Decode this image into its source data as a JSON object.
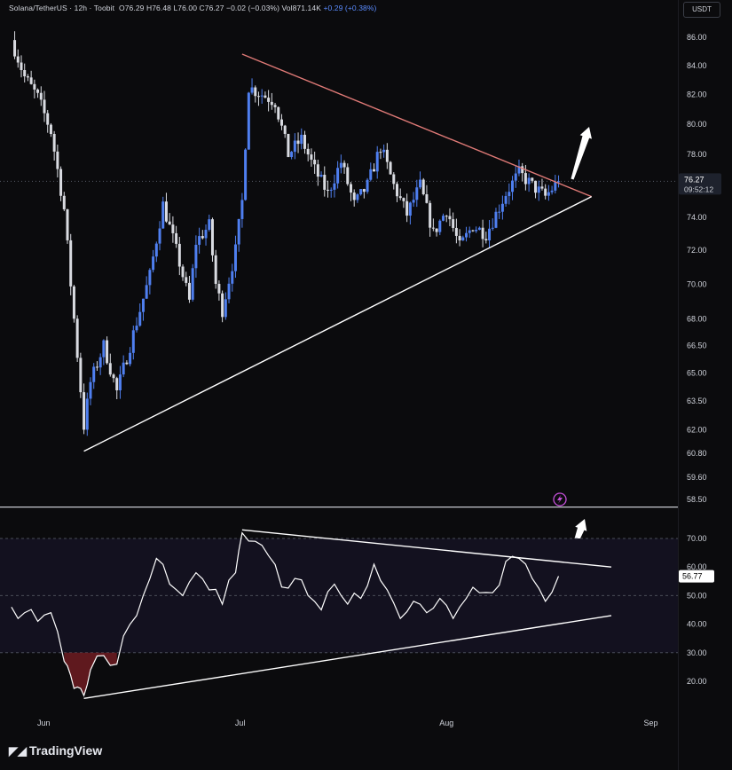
{
  "header": {
    "symbol": "Solana/TetherUS · 12h · Toobit",
    "open": "O76.29",
    "high": "H76.48",
    "low": "L76.00",
    "close": "C76.27",
    "change": "−0.02 (−0.03%)",
    "volume": "Vol871.14K",
    "vol_change": "+0.29 (+0.38%)",
    "currency_badge": "USDT"
  },
  "footer": {
    "brand": "TradingView",
    "logo_icon": "tradingview-logo-icon"
  },
  "price_badge": {
    "price": "76.27",
    "countdown": "09:52:12"
  },
  "rsi_badge": {
    "value": "56.77"
  },
  "colors": {
    "background": "#0b0b0d",
    "up_candle": "#4f7ff0",
    "down_candle": "#d9dbe1",
    "resistance_line": "#e07a77",
    "support_line": "#ffffff",
    "rsi_band": "#13111f",
    "rsi_line": "#ffffff",
    "oversold_fill": "#6e1c22"
  },
  "chart_data": [
    {
      "type": "candlestick",
      "name": "Solana/TetherUS 12h",
      "y_axis_ticks": [
        "86.00",
        "84.00",
        "82.00",
        "80.00",
        "78.00",
        "76.00",
        "74.00",
        "72.00",
        "70.00",
        "68.00",
        "66.50",
        "65.00",
        "63.50",
        "62.00",
        "60.80",
        "59.60",
        "58.50"
      ],
      "y_scale": "log",
      "x_axis_ticks": [
        "Jun",
        "Jul",
        "Aug",
        "Sep"
      ],
      "current_price": 76.27,
      "close_path_approx": [
        {
          "x": "May 27",
          "y": 85.8
        },
        {
          "x": "May 29",
          "y": 83.2
        },
        {
          "x": "May 31",
          "y": 81.8
        },
        {
          "x": "Jun 2",
          "y": 79.5
        },
        {
          "x": "Jun 4",
          "y": 74.5
        },
        {
          "x": "Jun 5",
          "y": 70.0
        },
        {
          "x": "Jun 6",
          "y": 66.0
        },
        {
          "x": "Jun 7",
          "y": 62.2
        },
        {
          "x": "Jun 8",
          "y": 64.5
        },
        {
          "x": "Jun 10",
          "y": 66.5
        },
        {
          "x": "Jun 12",
          "y": 64.0
        },
        {
          "x": "Jun 14",
          "y": 66.5
        },
        {
          "x": "Jun 17",
          "y": 70.5
        },
        {
          "x": "Jun 19",
          "y": 74.8
        },
        {
          "x": "Jun 21",
          "y": 72.0
        },
        {
          "x": "Jun 23",
          "y": 69.0
        },
        {
          "x": "Jun 24",
          "y": 72.5
        },
        {
          "x": "Jun 26",
          "y": 73.5
        },
        {
          "x": "Jun 27",
          "y": 70.0
        },
        {
          "x": "Jun 28",
          "y": 68.5
        },
        {
          "x": "Jun 30",
          "y": 72.0
        },
        {
          "x": "Jul 1",
          "y": 75.0
        },
        {
          "x": "Jul 2",
          "y": 82.5
        },
        {
          "x": "Jul 4",
          "y": 82.0
        },
        {
          "x": "Jul 6",
          "y": 81.5
        },
        {
          "x": "Jul 8",
          "y": 78.0
        },
        {
          "x": "Jul 10",
          "y": 79.0
        },
        {
          "x": "Jul 12",
          "y": 77.0
        },
        {
          "x": "Jul 14",
          "y": 75.5
        },
        {
          "x": "Jul 16",
          "y": 77.5
        },
        {
          "x": "Jul 18",
          "y": 74.8
        },
        {
          "x": "Jul 20",
          "y": 76.0
        },
        {
          "x": "Jul 22",
          "y": 78.5
        },
        {
          "x": "Jul 24",
          "y": 76.0
        },
        {
          "x": "Jul 26",
          "y": 74.2
        },
        {
          "x": "Jul 28",
          "y": 76.0
        },
        {
          "x": "Jul 30",
          "y": 73.0
        },
        {
          "x": "Aug 1",
          "y": 74.5
        },
        {
          "x": "Aug 3",
          "y": 72.2
        },
        {
          "x": "Aug 5",
          "y": 73.5
        },
        {
          "x": "Aug 7",
          "y": 73.0
        },
        {
          "x": "Aug 8",
          "y": 73.8
        },
        {
          "x": "Aug 10",
          "y": 75.5
        },
        {
          "x": "Aug 12",
          "y": 76.8
        },
        {
          "x": "Aug 14",
          "y": 76.0
        },
        {
          "x": "Aug 16",
          "y": 75.3
        },
        {
          "x": "Aug 18",
          "y": 76.27
        }
      ],
      "trendlines": [
        {
          "name": "resistance",
          "from": {
            "x": "Jul 1",
            "y": 84.8
          },
          "to": {
            "x": "Aug 23",
            "y": 75.3
          }
        },
        {
          "name": "support",
          "from": {
            "x": "Jun 7",
            "y": 60.9
          },
          "to": {
            "x": "Aug 23",
            "y": 75.3
          }
        }
      ]
    },
    {
      "type": "line",
      "name": "RSI",
      "y_axis_ticks": [
        "70.00",
        "60.00",
        "50.00",
        "40.00",
        "30.00",
        "20.00"
      ],
      "ylim": [
        12,
        76
      ],
      "band": [
        30,
        70
      ],
      "midline": 50,
      "current_value": 56.77,
      "values_approx": [
        {
          "x": "May 27",
          "y": 46
        },
        {
          "x": "May 29",
          "y": 44
        },
        {
          "x": "May 31",
          "y": 41
        },
        {
          "x": "Jun 2",
          "y": 44
        },
        {
          "x": "Jun 4",
          "y": 27
        },
        {
          "x": "Jun 5",
          "y": 22
        },
        {
          "x": "Jun 6",
          "y": 18
        },
        {
          "x": "Jun 7",
          "y": 15
        },
        {
          "x": "Jun 8",
          "y": 24
        },
        {
          "x": "Jun 10",
          "y": 29
        },
        {
          "x": "Jun 12",
          "y": 26
        },
        {
          "x": "Jun 14",
          "y": 40
        },
        {
          "x": "Jun 16",
          "y": 50
        },
        {
          "x": "Jun 18",
          "y": 63
        },
        {
          "x": "Jun 20",
          "y": 54
        },
        {
          "x": "Jun 22",
          "y": 50
        },
        {
          "x": "Jun 24",
          "y": 58
        },
        {
          "x": "Jun 26",
          "y": 52
        },
        {
          "x": "Jun 28",
          "y": 47
        },
        {
          "x": "Jun 30",
          "y": 58
        },
        {
          "x": "Jul 1",
          "y": 72
        },
        {
          "x": "Jul 3",
          "y": 69
        },
        {
          "x": "Jul 5",
          "y": 64
        },
        {
          "x": "Jul 7",
          "y": 53
        },
        {
          "x": "Jul 9",
          "y": 56
        },
        {
          "x": "Jul 11",
          "y": 50
        },
        {
          "x": "Jul 13",
          "y": 45
        },
        {
          "x": "Jul 15",
          "y": 54
        },
        {
          "x": "Jul 17",
          "y": 47
        },
        {
          "x": "Jul 19",
          "y": 49
        },
        {
          "x": "Jul 21",
          "y": 61
        },
        {
          "x": "Jul 23",
          "y": 52
        },
        {
          "x": "Jul 25",
          "y": 42
        },
        {
          "x": "Jul 27",
          "y": 48
        },
        {
          "x": "Jul 29",
          "y": 44
        },
        {
          "x": "Jul 31",
          "y": 49
        },
        {
          "x": "Aug 2",
          "y": 42
        },
        {
          "x": "Aug 4",
          "y": 49
        },
        {
          "x": "Aug 6",
          "y": 51
        },
        {
          "x": "Aug 8",
          "y": 51
        },
        {
          "x": "Aug 10",
          "y": 62
        },
        {
          "x": "Aug 12",
          "y": 63
        },
        {
          "x": "Aug 14",
          "y": 56
        },
        {
          "x": "Aug 16",
          "y": 48
        },
        {
          "x": "Aug 18",
          "y": 56.8
        }
      ],
      "trendlines": [
        {
          "name": "resistance",
          "from": {
            "x": "Jul 1",
            "y": 73
          },
          "to": {
            "x": "Aug 26",
            "y": 60
          }
        },
        {
          "name": "support",
          "from": {
            "x": "Jun 7",
            "y": 14
          },
          "to": {
            "x": "Aug 26",
            "y": 43
          }
        }
      ]
    }
  ]
}
